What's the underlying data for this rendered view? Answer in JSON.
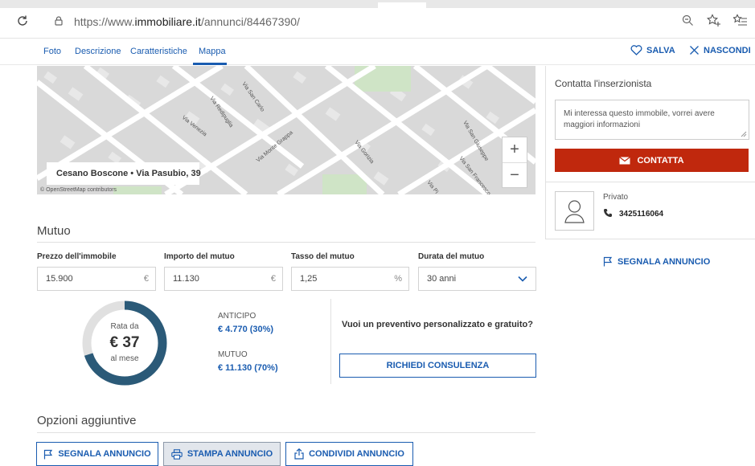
{
  "browser": {
    "url_prefix": "https://www.",
    "url_domain": "immobiliare.it",
    "url_path": "/annunci/84467390/"
  },
  "nav": {
    "tabs": [
      "Foto",
      "Descrizione",
      "Caratteristiche",
      "Mappa"
    ],
    "active_tab": "Mappa",
    "salva": "SALVA",
    "nascondi": "NASCONDI"
  },
  "map": {
    "location": "Cesano Boscone • Via Pasubio, 39",
    "attribution": "© OpenStreetMap contributors",
    "zoom_in": "+",
    "zoom_out": "−",
    "streets": [
      "Via San Carlo",
      "Via Redipuglia",
      "Via Venezia",
      "Via Monte Grappa",
      "Via Gorizia",
      "Via San Giuseppe",
      "Via San Francesco",
      "Via Pi"
    ]
  },
  "contact": {
    "title": "Contatta l'inserzionista",
    "message": "Mi interessa questo immobile, vorrei avere maggiori informazioni",
    "button": "CONTATTA",
    "role": "Privato",
    "phone": "3425116064",
    "report": "SEGNALA ANNUNCIO"
  },
  "mutuo": {
    "title": "Mutuo",
    "fields": [
      {
        "label": "Prezzo dell'immobile",
        "value": "15.900",
        "unit": "€"
      },
      {
        "label": "Importo del mutuo",
        "value": "11.130",
        "unit": "€"
      },
      {
        "label": "Tasso del mutuo",
        "value": "1,25",
        "unit": "%"
      },
      {
        "label": "Durata del mutuo",
        "value": "30 anni"
      }
    ],
    "rata_label": "Rata da",
    "rata_value": "€ 37",
    "rata_unit": "al mese",
    "anticipo_label": "ANTICIPO",
    "anticipo_value": "€ 4.770 (30%)",
    "mutuo_label": "MUTUO",
    "mutuo_value": "€ 11.130 (70%)",
    "mutuo_fraction": 0.7,
    "quote_text": "Vuoi un preventivo personalizzato e gratuito?",
    "consulenza": "RICHIEDI CONSULENZA"
  },
  "options": {
    "title": "Opzioni aggiuntive",
    "segnala": "SEGNALA ANNUNCIO",
    "stampa": "STAMPA ANNUNCIO",
    "condividi": "CONDIVIDI ANNUNCIO"
  },
  "colors": {
    "accent": "#1a5cb0",
    "contatta": "#c0280d",
    "ring": "#2b5a78",
    "ring_bg": "#e0e0e0"
  }
}
